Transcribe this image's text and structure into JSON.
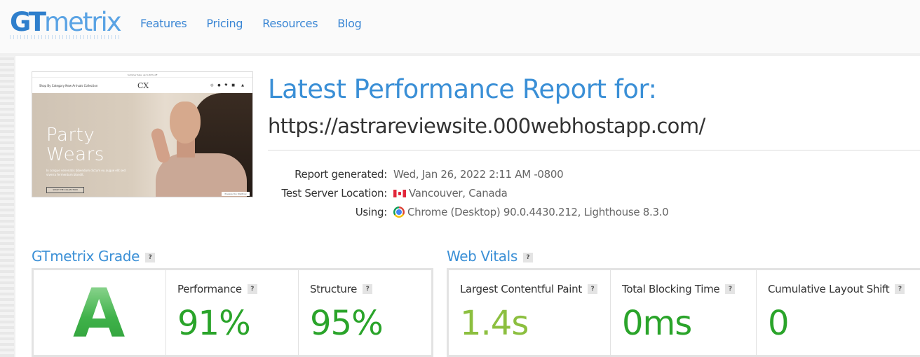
{
  "logo": {
    "gt": "GT",
    "metrix": "metrix"
  },
  "nav": [
    {
      "label": "Features"
    },
    {
      "label": "Pricing"
    },
    {
      "label": "Resources"
    },
    {
      "label": "Blog"
    }
  ],
  "thumbnail": {
    "promo": "Summer Sale: up to 40% off",
    "links": "Shop By Category   New Arrivals   Collection",
    "brand": "CX",
    "hero_title_line1": "Party",
    "hero_title_line2": "Wears",
    "hero_sub": "In congue venenatis bibendum dictum eu augue elit sed viverra fermentum blandit.",
    "hero_button": "SHOP THE COLLECTION",
    "badge": "Powered by Webflow"
  },
  "report": {
    "title": "Latest Performance Report for:",
    "url": "https://astrareviewsite.000webhostapp.com/",
    "meta": [
      {
        "label": "Report generated:",
        "value": "Wed, Jan 26, 2022 2:11 AM -0800",
        "icon": ""
      },
      {
        "label": "Test Server Location:",
        "value": "Vancouver, Canada",
        "icon": "canada-flag-icon"
      },
      {
        "label": "Using:",
        "value": "Chrome (Desktop) 90.0.4430.212, Lighthouse 8.3.0",
        "icon": "chrome-icon"
      }
    ]
  },
  "grade": {
    "title": "GTmetrix Grade",
    "help": "?",
    "letter": "A",
    "performance": {
      "label": "Performance",
      "value": "91%"
    },
    "structure": {
      "label": "Structure",
      "value": "95%"
    }
  },
  "vitals": {
    "title": "Web Vitals",
    "help": "?",
    "lcp": {
      "label": "Largest Contentful Paint",
      "value": "1.4s"
    },
    "tbt": {
      "label": "Total Blocking Time",
      "value": "0ms"
    },
    "cls": {
      "label": "Cumulative Layout Shift",
      "value": "0"
    }
  },
  "colors": {
    "accent": "#3a8fd6",
    "good": "#2aa42a",
    "lcp_good": "#8cbf3f"
  }
}
